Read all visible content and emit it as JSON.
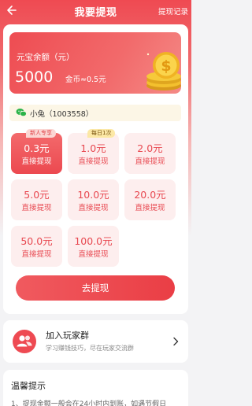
{
  "header": {
    "title": "我要提现",
    "records_label": "提现记录"
  },
  "balance": {
    "label": "元宝余额（元）",
    "value": "5000",
    "unit_text": "金币≈0.5元"
  },
  "user": {
    "display": "小兔（1003558）"
  },
  "options": [
    {
      "amount": "0.3元",
      "sub": "直接提现",
      "tag": "新人专享",
      "selected": true
    },
    {
      "amount": "1.0元",
      "sub": "直接提现",
      "tag": "每日1次",
      "selected": false
    },
    {
      "amount": "2.0元",
      "sub": "直接提现",
      "tag": "",
      "selected": false
    },
    {
      "amount": "5.0元",
      "sub": "直接提现",
      "tag": "",
      "selected": false
    },
    {
      "amount": "10.0元",
      "sub": "直接提现",
      "tag": "",
      "selected": false
    },
    {
      "amount": "20.0元",
      "sub": "直接提现",
      "tag": "",
      "selected": false
    },
    {
      "amount": "50.0元",
      "sub": "直接提现",
      "tag": "",
      "selected": false
    },
    {
      "amount": "100.0元",
      "sub": "直接提现",
      "tag": "",
      "selected": false
    }
  ],
  "withdraw_button": "去提现",
  "group": {
    "title": "加入玩家群",
    "subtitle": "学习赚钱技巧，尽在玩家交流群"
  },
  "tips": {
    "title": "温馨提示",
    "line1": "1、提现金额一般会在24小时内到账，如遇节假日"
  },
  "colors": {
    "accent": "#ee4a52",
    "option_bg": "#fdeeee",
    "tag_daily_bg": "#fce8a6",
    "user_row_bg": "#fcf6e6"
  },
  "icons": {
    "back": "back-arrow-icon",
    "coins": "gold-coin-stack-icon",
    "wechat": "wechat-icon",
    "group": "group-people-icon",
    "chevron": "chevron-right-icon"
  }
}
